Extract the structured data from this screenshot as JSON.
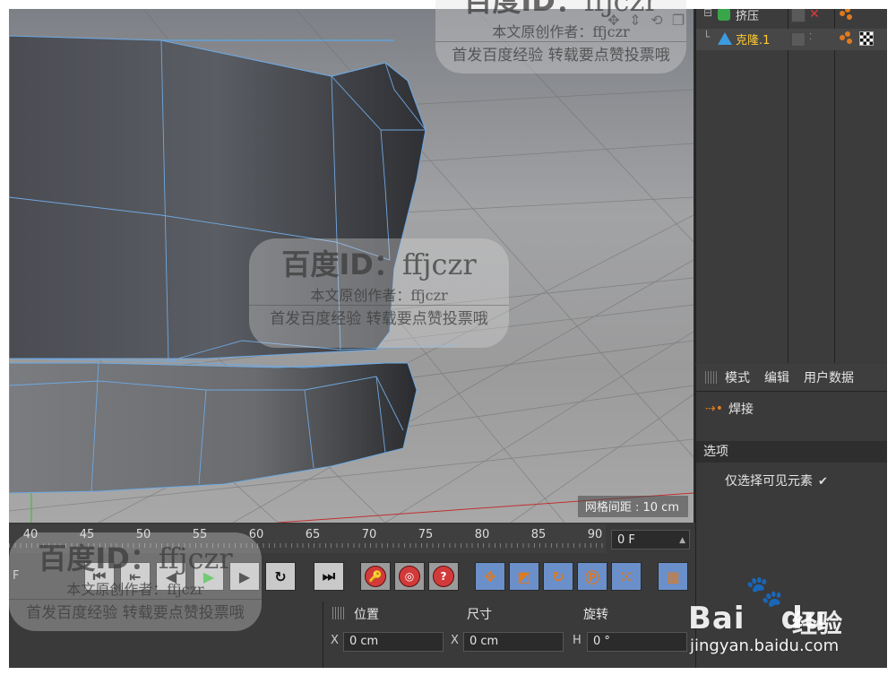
{
  "viewport": {
    "grid_distance": "网格间距 : 10 cm",
    "nav_icons": [
      "move-view-icon",
      "zoom-view-icon",
      "rotate-view-icon",
      "toggle-view-icon"
    ]
  },
  "object_manager": {
    "objects": [
      {
        "name": "挤压",
        "icon": "extrude-icon",
        "color": "#3aa64a",
        "tree": "⊟"
      },
      {
        "name": "克隆.1",
        "icon": "cloner-icon",
        "color": "#3c9be0",
        "tree": "└",
        "selected": true
      }
    ]
  },
  "attribute_manager": {
    "tabs": [
      "模式",
      "编辑",
      "用户数据"
    ],
    "tool_name": "焊接",
    "section": "选项",
    "option_label": "仅选择可见元素",
    "option_checked": "✔"
  },
  "timeline": {
    "tick_labels": [
      "40",
      "45",
      "50",
      "55",
      "60",
      "65",
      "70",
      "75",
      "80",
      "85",
      "90"
    ],
    "current_frame": "0 F",
    "left_frame": "F"
  },
  "transport": {
    "buttons": [
      "go-start-icon",
      "prev-key-icon",
      "prev-frame-icon",
      "play-icon",
      "next-frame-icon",
      "loop-icon",
      "go-end-icon",
      "record-icon",
      "autokey-icon",
      "help-key-icon",
      "move-key-icon",
      "scale-key-icon",
      "rotate-key-icon",
      "param-key-icon",
      "pla-key-icon",
      "film-icon"
    ]
  },
  "coordinates": {
    "headers": [
      "位置",
      "尺寸",
      "旋转"
    ],
    "rows": [
      {
        "axis1": "X",
        "pos": "0 cm",
        "axis2": "X",
        "size": "0 cm",
        "axis3": "H",
        "rot": "0 °"
      }
    ]
  },
  "watermark": {
    "title": "百度ID：",
    "id": "ffjczr",
    "line1": "本文原创作者：ffjczr",
    "line2": "首发百度经验 转载要点赞投票哦"
  },
  "brand": {
    "logo_text": "Bai",
    "logo_text2": "du",
    "jingyan": "经验",
    "url": "jingyan.baidu.com"
  }
}
